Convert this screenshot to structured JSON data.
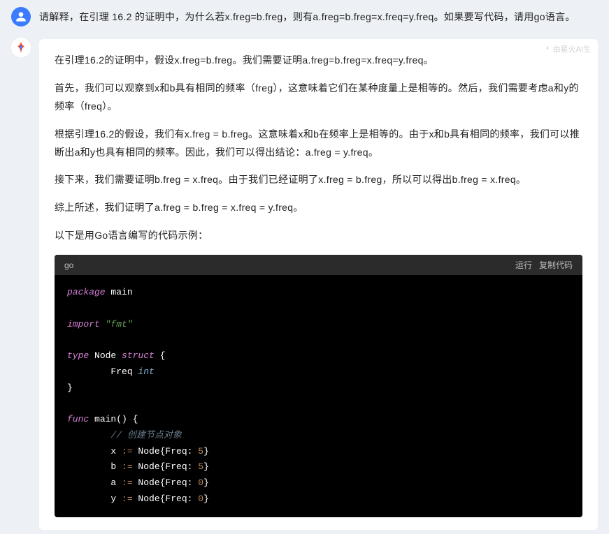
{
  "user": {
    "text": "请解释，在引理 16.2 的证明中，为什么若x.freg=b.freg，则有a.freg=b.freg=x.freq=y.freq。如果要写代码，请用go语言。"
  },
  "ai": {
    "badge": "由星火AI生",
    "paragraphs": [
      "在引理16.2的证明中，假设x.freg=b.freg。我们需要证明a.freg=b.freg=x.freq=y.freq。",
      "首先，我们可以观察到x和b具有相同的频率（freg），这意味着它们在某种度量上是相等的。然后，我们需要考虑a和y的频率（freq）。",
      "根据引理16.2的假设，我们有x.freg = b.freg。这意味着x和b在频率上是相等的。由于x和b具有相同的频率，我们可以推断出a和y也具有相同的频率。因此，我们可以得出结论：a.freg = y.freq。",
      "接下来，我们需要证明b.freg = x.freq。由于我们已经证明了x.freg = b.freg，所以可以得出b.freg = x.freq。",
      "综上所述，我们证明了a.freg = b.freg = x.freq = y.freq。",
      "以下是用Go语言编写的代码示例："
    ]
  },
  "code": {
    "lang": "go",
    "run_label": "运行",
    "copy_label": "复制代码",
    "lines": {
      "pkg_kw": "package",
      "pkg_name": " main",
      "imp_kw": "import",
      "imp_val": " \"fmt\"",
      "type_kw": "type",
      "type_name": " Node ",
      "struct_kw": "struct",
      "struct_open": " {",
      "field": "        Freq ",
      "field_type": "int",
      "close_brace": "}",
      "func_kw": "func",
      "main_name": " main() {",
      "comment": "        // 创建节点对象",
      "x_line_a": "        x ",
      "assign": ":=",
      "x_line_b": " Node{Freq: ",
      "five": "5",
      "line_end": "}",
      "b_line_a": "        b ",
      "a_line_a": "        a ",
      "zero": "0",
      "y_line_a": "        y "
    }
  }
}
